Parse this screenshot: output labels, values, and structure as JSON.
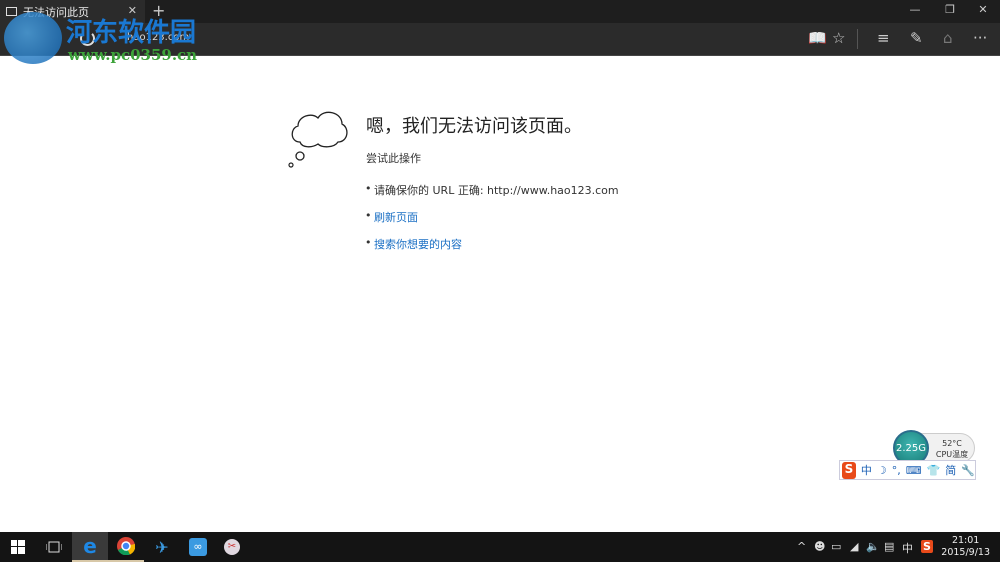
{
  "tab": {
    "title": "无法访问此页",
    "close": "✕",
    "new_tab": "+"
  },
  "window": {
    "minimize": "—",
    "restore": "❐",
    "close": "✕"
  },
  "address": {
    "url": "hao123.com"
  },
  "toolbar": {
    "reading": "📖",
    "favorite": "☆",
    "hub": "≡",
    "note": "✎",
    "share": "⌂",
    "more": "···"
  },
  "watermark": {
    "name": "河东软件园",
    "url": "www.pc0359.cn"
  },
  "error": {
    "heading": "嗯，我们无法访问该页面。",
    "subheading": "尝试此操作",
    "items": [
      {
        "label": "请确保你的 URL 正确: http://www.hao123.com"
      },
      {
        "label": "刷新页面"
      },
      {
        "label": "搜索你想要的内容"
      }
    ]
  },
  "cpu_widget": {
    "memory": "2.25G",
    "temp": "52°C",
    "label": "CPU温度"
  },
  "ime_bar": {
    "logo": "S",
    "mode": "中",
    "items": [
      "☽",
      "°,",
      "⌨",
      "👕",
      "简",
      "🔧"
    ]
  },
  "taskbar": {
    "tray_ime": "中",
    "time": "21:01",
    "date": "2015/9/13"
  }
}
